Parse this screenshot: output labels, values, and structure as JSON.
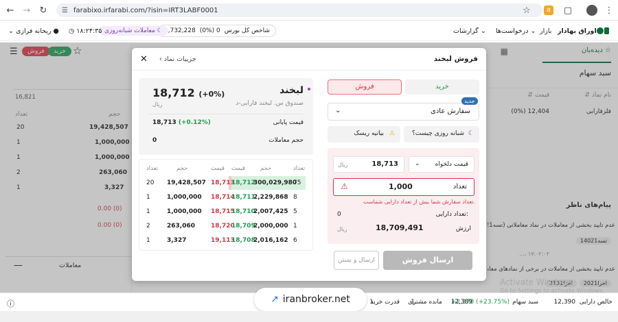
{
  "browser": {
    "url": "farabixo.irfarabi.com/?isin=IRT3LABF0001"
  },
  "header": {
    "brand": "اوراق بهادار",
    "nav": [
      "بازار",
      "درخواست‌ها",
      "گزارشات"
    ],
    "index_label": "شاخص کل بورس",
    "index_value": "2,732,228",
    "index_change": "(0%) 0",
    "session_label": "معاملات شبانه‌روزی",
    "time": "۱۸:۲۴:۳۵",
    "user": "ریحانه فرازی"
  },
  "left_panel": {
    "buy_label": "خرید",
    "sell_label": "فروش",
    "top_value": "16,821",
    "col_volume": "حجم",
    "col_count": "تعداد",
    "rows": [
      {
        "count": "20",
        "volume": "19,428,507"
      },
      {
        "count": "1",
        "volume": "1,000,000"
      },
      {
        "count": "1",
        "volume": "1,000,000"
      },
      {
        "count": "2",
        "volume": "263,060"
      },
      {
        "count": "1",
        "volume": "3,327"
      }
    ],
    "zero1": "0.00 (0)",
    "zero2": "0.00 (0)",
    "trades_label": "معاملات"
  },
  "right_panel": {
    "tab_watch": "دیده‌بان",
    "basket_title": "سبد سهام",
    "col_symbol": "نام نماد",
    "col_price": "قیمت",
    "row_symbol": "فلزفارابی",
    "row_price": "12,404",
    "row_change": "(0%)",
    "messages_title": "پیام‌های ناظر",
    "msg1": "عدم تایید بخشی از معاملات در نماد معاملاتی (تسه1021",
    "msg1_tag": "تسه14021",
    "msg1_time": "۱۷:۰۲:۰۲ ،...",
    "msg2": "عدم تایید بخشی از معاملات در برخی از نمادهای معاملا",
    "msg2_tag1": "اخزا2021",
    "msg2_tag2": "اخزا2131"
  },
  "modal": {
    "title": "فروش لبخند",
    "details_link": "جزییات نماد",
    "tab_buy": "خرید",
    "tab_sell": "فروش",
    "new_badge": "جدید",
    "order_type": "سفارش عادی",
    "risk_label": "بیانیه ریسک",
    "daynight_label": "شبانه روزی چیست؟",
    "price_type": "قیمت دلخواه",
    "price_value": "18,713",
    "currency": "ریال",
    "qty_label": "تعداد",
    "qty_value": "1,000",
    "error_msg": "تعداد سفارش شما بیش از تعداد دارایی شماست.",
    "holding_label": "تعداد دارایی:",
    "holding_value": "0",
    "value_label": "ارزش",
    "value_amount": "18,709,491",
    "submit_sell": "ارسال فروش",
    "submit_close": "ارسال و بستن",
    "symbol": "لبخند",
    "symbol_desc": "صندوق س. لبخند فارابی-د",
    "last_price": "18,712",
    "last_change": "(+0%)",
    "close_label": "قیمت پایانی",
    "close_value": "18,713",
    "close_change": "(+0.12%)",
    "volume_label": "حجم معاملات",
    "volume_value": "0",
    "ob_headers": [
      "تعداد",
      "حجم",
      "قیمت",
      "قیمت",
      "حجم",
      "تعداد"
    ],
    "orderbook": [
      {
        "buy_count": "75",
        "buy_volume": "300,029,980",
        "buy_price": "18,712",
        "sell_price": "18,713",
        "sell_volume": "19,428,507",
        "sell_count": "20"
      },
      {
        "buy_count": "8",
        "buy_volume": "2,229,868",
        "buy_price": "18,711",
        "sell_price": "18,714",
        "sell_volume": "1,000,000",
        "sell_count": "1"
      },
      {
        "buy_count": "5",
        "buy_volume": "2,007,425",
        "buy_price": "18,710",
        "sell_price": "18,715",
        "sell_volume": "1,000,000",
        "sell_count": "1"
      },
      {
        "buy_count": "1",
        "buy_volume": "2,000,000",
        "buy_price": "18,709",
        "sell_price": "18,720",
        "sell_volume": "263,060",
        "sell_count": "2"
      },
      {
        "buy_count": "6",
        "buy_volume": "2,016,162",
        "buy_price": "18,708",
        "sell_price": "19,113",
        "sell_volume": "3,327",
        "sell_count": "1"
      }
    ]
  },
  "bottom_bar": {
    "net_assets_label": "خالص دارایی",
    "net_assets": "12,390",
    "portfolio_label": "سبد سهام",
    "portfolio_change": "+2,378 (+23.75%)",
    "portfolio_value": "12,389",
    "balance_label": "مانده مشتری",
    "balance": "1",
    "buy_power_label": "قدرت خرید",
    "buy_power": "1"
  },
  "watermark": {
    "site": "iranbroker.net",
    "activate1": "Activate Windows",
    "activate2": "Go to Settings to activate Windows."
  },
  "colors": {
    "green": "#1f9a4f",
    "red": "#d93445",
    "accent_purple": "#7b3fb0"
  }
}
